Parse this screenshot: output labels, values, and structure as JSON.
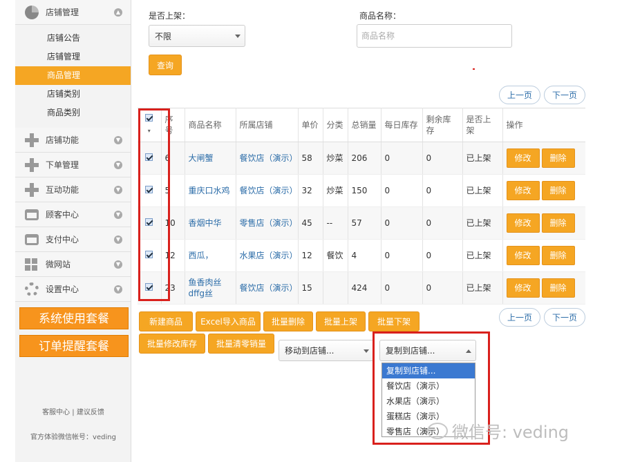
{
  "sidebar": {
    "store_mgmt": "店铺管理",
    "sub_items": [
      "店铺公告",
      "店铺管理",
      "商品管理",
      "店铺类别",
      "商品类别"
    ],
    "sections": [
      "店铺功能",
      "下单管理",
      "互动功能",
      "顾客中心",
      "支付中心",
      "微网站",
      "设置中心"
    ],
    "package_btn_1": "系统使用套餐",
    "package_btn_2": "订单提醒套餐",
    "footer_links": "客服中心 | 建议反馈",
    "footer_account": "官方体验微信帐号：veding"
  },
  "filters": {
    "listed_label": "是否上架：",
    "listed_value": "不限",
    "name_label": "商品名称：",
    "name_placeholder": "商品名称",
    "query_btn": "查询"
  },
  "pager": {
    "prev": "上一页",
    "next": "下一页"
  },
  "table": {
    "headers": [
      "序号",
      "商品名称",
      "所属店铺",
      "单价",
      "分类",
      "总销量",
      "每日库存",
      "剩余库存",
      "是否上架",
      "操作"
    ],
    "rows": [
      {
        "id": "6",
        "name": "大闸蟹",
        "store": "餐饮店（演示）",
        "price": "58",
        "category": "炒菜",
        "sales": "206",
        "daily": "0",
        "remain": "0",
        "listed": "已上架"
      },
      {
        "id": "5",
        "name": "重庆口水鸡",
        "store": "餐饮店（演示）",
        "price": "32",
        "category": "炒菜",
        "sales": "150",
        "daily": "0",
        "remain": "0",
        "listed": "已上架"
      },
      {
        "id": "10",
        "name": "香烟中华",
        "store": "零售店（演示）",
        "price": "45",
        "category": "--",
        "sales": "57",
        "daily": "0",
        "remain": "0",
        "listed": "已上架"
      },
      {
        "id": "12",
        "name": "西瓜，",
        "store": "水果店（演示）",
        "price": "12",
        "category": "餐饮",
        "sales": "4",
        "daily": "0",
        "remain": "0",
        "listed": "已上架"
      },
      {
        "id": "23",
        "name": "鱼香肉丝dffg丝",
        "store": "餐饮店（演示）",
        "price": "15",
        "category": "",
        "sales": "424",
        "daily": "0",
        "remain": "0",
        "listed": "已上架"
      }
    ],
    "edit_btn": "修改",
    "delete_btn": "删除"
  },
  "actions": {
    "new": "新建商品",
    "excel": "Excel导入商品",
    "batch_delete": "批量删除",
    "batch_up": "批量上架",
    "batch_down": "批量下架",
    "batch_stock": "批量修改库存",
    "batch_clear": "批量清零销量",
    "move_select": "移动到店铺...",
    "copy_select": "复制到店铺..."
  },
  "copy_options": [
    "复制到店铺...",
    "餐饮店（演示）",
    "水果店（演示）",
    "蛋糕店（演示）",
    "零售店（演示）"
  ],
  "watermark": "微信号: veding"
}
